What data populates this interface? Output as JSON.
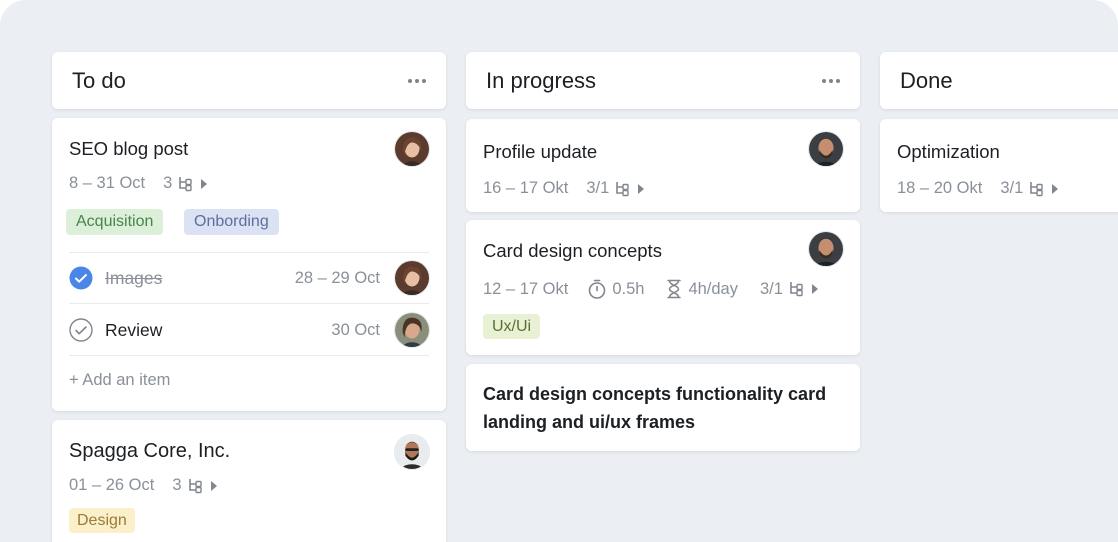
{
  "columns": {
    "todo": {
      "title": "To do",
      "cards": {
        "seo": {
          "title": "SEO blog post",
          "date": "8 – 31 Oct",
          "subtasks": "3",
          "tags": [
            "Acquisition",
            "Onbording"
          ],
          "checklist": [
            {
              "label": "Images",
              "date": "28 – 29 Oct",
              "done": true
            },
            {
              "label": "Review",
              "date": "30 Oct",
              "done": false
            }
          ],
          "add_item": "+ Add an item"
        },
        "spagga": {
          "title": "Spagga Core, Inc.",
          "date": "01 – 26 Oct",
          "subtasks": "3",
          "tags": [
            "Design"
          ]
        }
      }
    },
    "progress": {
      "title": "In progress",
      "cards": {
        "profile": {
          "title": "Profile update",
          "date": "16 – 17 Okt",
          "subtasks": "3/1"
        },
        "design": {
          "title": "Card design concepts",
          "date": "12 – 17 Okt",
          "time": "0.5h",
          "rate": "4h/day",
          "subtasks": "3/1",
          "tags": [
            "Ux/Ui"
          ]
        },
        "long": {
          "title": "Card design concepts functionality card landing and ui/ux frames"
        }
      }
    },
    "done": {
      "title": "Done",
      "cards": {
        "opt": {
          "title": "Optimization",
          "date": "18 – 20 Okt",
          "subtasks": "3/1"
        }
      }
    }
  },
  "colors": {
    "board_bg": "#ebeff3",
    "check_done": "#4a86e8",
    "tag_green": "#dcefd8",
    "tag_blue": "#dbe2f3",
    "tag_yellow": "#fbf0c9",
    "tag_lime": "#e8f1d3"
  },
  "icons": {
    "column_menu": "more-horizontal-icon",
    "subtasks": "subtasks-tree-icon",
    "expand": "caret-right-icon",
    "timer": "stopwatch-icon",
    "rate": "hourglass-icon",
    "check_done": "check-circle-filled-icon",
    "check_open": "check-circle-outline-icon"
  }
}
